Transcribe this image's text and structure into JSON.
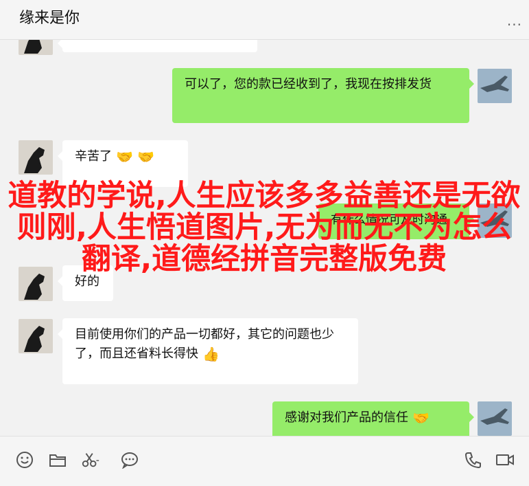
{
  "header": {
    "title": "缘来是你",
    "more_label": "..."
  },
  "messages": [
    {
      "side": "right",
      "text": "可以了，您的款已经收到了，我现在按排发货",
      "emoji": ""
    },
    {
      "side": "left",
      "text": "辛苦了",
      "emoji": "🤝 🤝"
    },
    {
      "side": "right",
      "text": "有什么情况可及时沟通",
      "emoji": ""
    },
    {
      "side": "left",
      "text": "好的",
      "emoji": ""
    },
    {
      "side": "left",
      "text": "目前使用你们的产品一切都好，其它的问题也少了，而且还省料长得快",
      "emoji": "👍"
    },
    {
      "side": "right",
      "text": "感谢对我们产品的信任",
      "emoji": "🤝"
    }
  ],
  "overlay_text": "道教的学说,人生应该多多益善还是无欲则刚,人生悟道图片,无为而无不为怎么翻译,道德经拼音完整版免费",
  "toolbar": {
    "icons": [
      "emoji-icon",
      "folder-icon",
      "scissors-icon",
      "chat-history-icon",
      "phone-icon",
      "video-call-icon"
    ]
  },
  "colors": {
    "right_bubble": "#95ec69",
    "left_bubble": "#ffffff",
    "overlay": "#ff1a1a",
    "background": "#f2f2f2"
  }
}
